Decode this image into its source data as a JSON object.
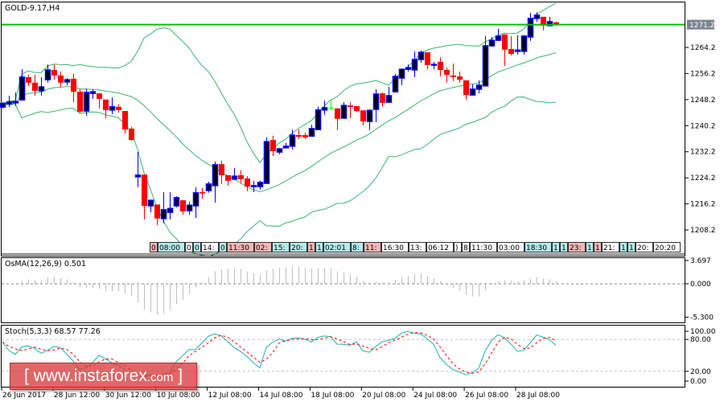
{
  "chart_data": {
    "type": "candlestick",
    "title": "GOLD-9.17,H4",
    "symbol": "GOLD-9.17",
    "timeframe": "H4",
    "ohlc": [
      [
        1245.9,
        1247.5,
        1245.5,
        1247.0
      ],
      [
        1246.8,
        1249.4,
        1245.9,
        1247.5
      ],
      [
        1247.2,
        1250.4,
        1246.2,
        1247.6
      ],
      [
        1248.1,
        1257.5,
        1248.1,
        1255.1
      ],
      [
        1255.1,
        1255.8,
        1252.4,
        1253.4
      ],
      [
        1253.4,
        1255.8,
        1249.4,
        1250.9
      ],
      [
        1250.9,
        1255.1,
        1249.4,
        1252.1
      ],
      [
        1254.3,
        1259.0,
        1253.4,
        1257.3
      ],
      [
        1257.3,
        1259.0,
        1254.3,
        1255.6
      ],
      [
        1255.6,
        1256.8,
        1251.9,
        1253.4
      ],
      [
        1253.6,
        1254.8,
        1252.6,
        1254.3
      ],
      [
        1254.6,
        1256.1,
        1247.4,
        1250.6
      ],
      [
        1250.6,
        1251.4,
        1244.2,
        1244.5
      ],
      [
        1244.7,
        1251.6,
        1243.2,
        1250.4
      ],
      [
        1250.1,
        1251.4,
        1248.4,
        1250.6
      ],
      [
        1250.1,
        1250.1,
        1245.5,
        1248.4
      ],
      [
        1248.2,
        1248.2,
        1242.5,
        1245.0
      ],
      [
        1245.0,
        1248.9,
        1243.7,
        1246.0
      ],
      [
        1246.0,
        1246.7,
        1244.2,
        1245.0
      ],
      [
        1244.7,
        1244.7,
        1237.8,
        1239.0
      ],
      [
        1239.3,
        1239.8,
        1235.6,
        1235.8
      ],
      [
        1224.5,
        1232.1,
        1221.3,
        1225.0
      ],
      [
        1225.2,
        1225.2,
        1211.4,
        1215.6
      ],
      [
        1215.6,
        1217.3,
        1213.6,
        1217.3
      ],
      [
        1216.0,
        1216.0,
        1209.7,
        1211.7
      ],
      [
        1211.7,
        1219.8,
        1210.2,
        1214.4
      ],
      [
        1213.6,
        1219.8,
        1211.4,
        1214.8
      ],
      [
        1215.6,
        1218.6,
        1215.1,
        1218.1
      ],
      [
        1217.3,
        1217.3,
        1212.9,
        1213.9
      ],
      [
        1214.1,
        1216.8,
        1212.9,
        1215.8
      ],
      [
        1215.6,
        1221.3,
        1211.9,
        1219.6
      ],
      [
        1219.8,
        1221.1,
        1217.8,
        1219.4
      ],
      [
        1220.3,
        1223.0,
        1219.6,
        1222.3
      ],
      [
        1221.8,
        1229.2,
        1216.6,
        1228.2
      ],
      [
        1228.4,
        1229.4,
        1222.3,
        1225.0
      ],
      [
        1225.0,
        1225.0,
        1221.8,
        1223.3
      ],
      [
        1223.8,
        1227.2,
        1223.5,
        1224.7
      ],
      [
        1225.0,
        1226.5,
        1222.5,
        1223.8
      ],
      [
        1224.0,
        1224.7,
        1220.1,
        1221.5
      ],
      [
        1221.5,
        1223.3,
        1219.8,
        1221.8
      ],
      [
        1221.5,
        1223.3,
        1220.6,
        1222.8
      ],
      [
        1222.5,
        1236.6,
        1222.5,
        1235.3
      ],
      [
        1235.8,
        1237.1,
        1230.9,
        1232.4
      ],
      [
        1232.1,
        1233.4,
        1231.4,
        1233.1
      ],
      [
        1233.4,
        1234.9,
        1233.4,
        1233.9
      ],
      [
        1233.9,
        1239.0,
        1232.9,
        1237.3
      ],
      [
        1237.3,
        1239.0,
        1236.1,
        1236.8
      ],
      [
        1237.3,
        1238.1,
        1236.1,
        1236.6
      ],
      [
        1237.0,
        1240.5,
        1236.8,
        1239.3
      ],
      [
        1239.0,
        1246.0,
        1238.8,
        1245.0
      ],
      [
        1245.0,
        1247.9,
        1243.5,
        1245.7
      ],
      [
        1245.7,
        1247.9,
        1245.0,
        1245.7
      ],
      [
        1245.5,
        1245.5,
        1238.8,
        1242.3
      ],
      [
        1242.5,
        1247.4,
        1242.3,
        1246.4
      ],
      [
        1246.4,
        1247.4,
        1242.5,
        1245.9
      ],
      [
        1246.2,
        1246.2,
        1244.4,
        1244.7
      ],
      [
        1244.9,
        1244.9,
        1240.3,
        1241.5
      ],
      [
        1241.5,
        1245.2,
        1238.8,
        1244.9
      ],
      [
        1245.2,
        1251.4,
        1241.3,
        1249.9
      ],
      [
        1250.1,
        1250.4,
        1246.0,
        1247.2
      ],
      [
        1247.4,
        1252.1,
        1247.4,
        1249.4
      ],
      [
        1250.6,
        1256.1,
        1250.4,
        1255.3
      ],
      [
        1254.8,
        1257.8,
        1252.6,
        1257.5
      ],
      [
        1257.5,
        1259.0,
        1256.8,
        1258.0
      ],
      [
        1257.3,
        1263.0,
        1255.1,
        1260.5
      ],
      [
        1260.5,
        1263.2,
        1259.5,
        1262.7
      ],
      [
        1262.7,
        1262.7,
        1257.5,
        1258.8
      ],
      [
        1258.8,
        1259.8,
        1257.5,
        1259.0
      ],
      [
        1259.8,
        1261.2,
        1255.3,
        1257.3
      ],
      [
        1257.3,
        1258.0,
        1253.4,
        1255.8
      ],
      [
        1255.6,
        1259.3,
        1253.9,
        1255.1
      ],
      [
        1255.3,
        1256.8,
        1253.4,
        1254.3
      ],
      [
        1254.1,
        1254.1,
        1248.2,
        1249.6
      ],
      [
        1249.6,
        1252.9,
        1249.6,
        1251.4
      ],
      [
        1251.4,
        1254.1,
        1250.1,
        1252.6
      ],
      [
        1252.4,
        1267.7,
        1252.4,
        1264.7
      ],
      [
        1264.7,
        1267.4,
        1264.4,
        1266.4
      ],
      [
        1266.4,
        1269.9,
        1266.2,
        1267.7
      ],
      [
        1268.2,
        1268.2,
        1258.5,
        1263.5
      ],
      [
        1263.7,
        1267.7,
        1261.7,
        1262.2
      ],
      [
        1263.0,
        1267.9,
        1262.0,
        1263.4
      ],
      [
        1263.0,
        1267.7,
        1262.0,
        1267.7
      ],
      [
        1267.4,
        1274.8,
        1266.2,
        1273.1
      ],
      [
        1273.1,
        1275.0,
        1272.1,
        1274.1
      ],
      [
        1273.6,
        1273.6,
        1269.4,
        1270.9
      ],
      [
        1270.9,
        1273.6,
        1270.9,
        1272.1
      ],
      [
        1271.9,
        1272.1,
        1270.9,
        1271.2
      ]
    ],
    "doji_index": [
      51
    ],
    "price_ticks": [
      "1264.2",
      "1256.2",
      "1248.2",
      "1240.2",
      "1232.2",
      "1224.2",
      "1216.2",
      "1208.2"
    ],
    "price_range": [
      1208.2,
      1264.2
    ],
    "horizontal_line": {
      "price": 1271.2,
      "label": "1271.2"
    },
    "bollinger": {
      "period": 20,
      "deviation": 2
    },
    "time_labels": [
      "26 Jun 2017",
      "28 Jun 12:00",
      "30 Jun 12:00",
      "10 Jul 08:00",
      "12 Jul 08:00",
      "14 Jul 08:00",
      "18 Jul 08:00",
      "20 Jul 08:00",
      "24 Jul 08:00",
      "26 Jul 08:00",
      "28 Jul 08:00"
    ],
    "osma": {
      "label": "OsMA(12,26,9) 0.501",
      "ticks": [
        "3.697",
        "0.000",
        "-5.300"
      ],
      "range": [
        -5.3,
        3.697
      ]
    },
    "stoch": {
      "label": "Stoch(5,3,3) 68.57 77.26",
      "ticks": [
        "100.00",
        "80.00",
        "20.00",
        "0.00"
      ],
      "levels": [
        80,
        20
      ]
    }
  },
  "event_labels": [
    {
      "t": "0",
      "c": "pink"
    },
    {
      "t": "08:00",
      "c": "cyan"
    },
    {
      "t": "0",
      "c": "white"
    },
    {
      "t": "0",
      "c": "cyan"
    },
    {
      "t": "14:",
      "c": "white"
    },
    {
      "t": "0",
      "c": "cyan"
    },
    {
      "t": "11:30",
      "c": "pink"
    },
    {
      "t": "02:",
      "c": "pink"
    },
    {
      "t": "15:",
      "c": "cyan"
    },
    {
      "t": "20:",
      "c": "cyan"
    },
    {
      "t": "1",
      "c": "pink"
    },
    {
      "t": "1",
      "c": "cyan"
    },
    {
      "t": "02:01",
      "c": "cyan"
    },
    {
      "t": "8:",
      "c": "cyan"
    },
    {
      "t": "11:",
      "c": "pink"
    },
    {
      "t": "16:30",
      "c": "white"
    },
    {
      "t": "13:",
      "c": "white"
    },
    {
      "t": "06:12",
      "c": "white"
    },
    {
      "t": ")",
      "c": "white"
    },
    {
      "t": "8",
      "c": "white"
    },
    {
      "t": "11:30",
      "c": "white"
    },
    {
      "t": "03:00",
      "c": "white"
    },
    {
      "t": "18:30",
      "c": "cyan"
    },
    {
      "t": "1",
      "c": "cyan"
    },
    {
      "t": "1",
      "c": "cyan"
    },
    {
      "t": "23:",
      "c": "pink"
    },
    {
      "t": "1",
      "c": "cyan"
    },
    {
      "t": "1",
      "c": "pink"
    },
    {
      "t": "21:",
      "c": "white"
    },
    {
      "t": "1",
      "c": "cyan"
    },
    {
      "t": "1",
      "c": "cyan"
    },
    {
      "t": "20:",
      "c": "white"
    },
    {
      "t": "20:20",
      "c": "white"
    }
  ],
  "watermark": {
    "open": "[",
    "site": "www.instaforex",
    "tld": ".com",
    "close": "]"
  },
  "colors": {
    "bull": "#0000ff",
    "bear": "#ff0000",
    "doji": "#00ff00",
    "band": "#3cb371",
    "hline": "#00c000",
    "osma": "#c0c0c0",
    "stoch_main": "#20b2aa",
    "stoch_signal": "#ff0000",
    "pink": "#f4b6b6",
    "cyan": "#b4ecec",
    "white": "#ffffff"
  }
}
